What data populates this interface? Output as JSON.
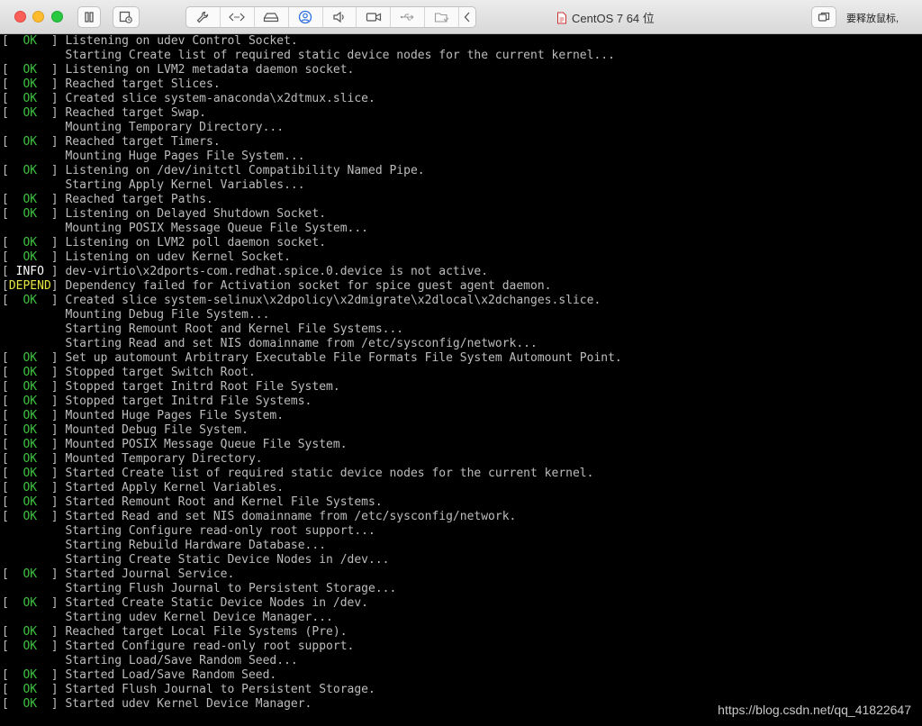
{
  "window": {
    "title": "CentOS 7 64 位",
    "hint_text": "要释放鼠标,",
    "toolbar": {
      "icons": [
        "pause-icon",
        "snapshot-icon",
        "wrench-icon",
        "code-arrows-icon",
        "disk-icon",
        "user-icon",
        "speaker-icon",
        "camera-icon",
        "usb-icon",
        "shared-folder-icon",
        "chevron-left-icon",
        "fullscreen-icon"
      ]
    }
  },
  "terminal": {
    "lines": [
      {
        "status": "OK",
        "text": "Listening on udev Control Socket."
      },
      {
        "status": "",
        "text": "Starting Create list of required static device nodes for the current kernel..."
      },
      {
        "status": "OK",
        "text": "Listening on LVM2 metadata daemon socket."
      },
      {
        "status": "OK",
        "text": "Reached target Slices."
      },
      {
        "status": "OK",
        "text": "Created slice system-anaconda\\x2dtmux.slice."
      },
      {
        "status": "OK",
        "text": "Reached target Swap."
      },
      {
        "status": "",
        "text": "Mounting Temporary Directory..."
      },
      {
        "status": "OK",
        "text": "Reached target Timers."
      },
      {
        "status": "",
        "text": "Mounting Huge Pages File System..."
      },
      {
        "status": "OK",
        "text": "Listening on /dev/initctl Compatibility Named Pipe."
      },
      {
        "status": "",
        "text": "Starting Apply Kernel Variables..."
      },
      {
        "status": "OK",
        "text": "Reached target Paths."
      },
      {
        "status": "OK",
        "text": "Listening on Delayed Shutdown Socket."
      },
      {
        "status": "",
        "text": "Mounting POSIX Message Queue File System..."
      },
      {
        "status": "OK",
        "text": "Listening on LVM2 poll daemon socket."
      },
      {
        "status": "OK",
        "text": "Listening on udev Kernel Socket."
      },
      {
        "status": "INFO",
        "text": "dev-virtio\\x2dports-com.redhat.spice.0.device is not active."
      },
      {
        "status": "DEPEND",
        "text": "Dependency failed for Activation socket for spice guest agent daemon."
      },
      {
        "status": "OK",
        "text": "Created slice system-selinux\\x2dpolicy\\x2dmigrate\\x2dlocal\\x2dchanges.slice."
      },
      {
        "status": "",
        "text": "Mounting Debug File System..."
      },
      {
        "status": "",
        "text": "Starting Remount Root and Kernel File Systems..."
      },
      {
        "status": "",
        "text": "Starting Read and set NIS domainname from /etc/sysconfig/network..."
      },
      {
        "status": "OK",
        "text": "Set up automount Arbitrary Executable File Formats File System Automount Point."
      },
      {
        "status": "OK",
        "text": "Stopped target Switch Root."
      },
      {
        "status": "OK",
        "text": "Stopped target Initrd Root File System."
      },
      {
        "status": "OK",
        "text": "Stopped target Initrd File Systems."
      },
      {
        "status": "OK",
        "text": "Mounted Huge Pages File System."
      },
      {
        "status": "OK",
        "text": "Mounted Debug File System."
      },
      {
        "status": "OK",
        "text": "Mounted POSIX Message Queue File System."
      },
      {
        "status": "OK",
        "text": "Mounted Temporary Directory."
      },
      {
        "status": "OK",
        "text": "Started Create list of required static device nodes for the current kernel."
      },
      {
        "status": "OK",
        "text": "Started Apply Kernel Variables."
      },
      {
        "status": "OK",
        "text": "Started Remount Root and Kernel File Systems."
      },
      {
        "status": "OK",
        "text": "Started Read and set NIS domainname from /etc/sysconfig/network."
      },
      {
        "status": "",
        "text": "Starting Configure read-only root support..."
      },
      {
        "status": "",
        "text": "Starting Rebuild Hardware Database..."
      },
      {
        "status": "",
        "text": "Starting Create Static Device Nodes in /dev..."
      },
      {
        "status": "OK",
        "text": "Started Journal Service."
      },
      {
        "status": "",
        "text": "Starting Flush Journal to Persistent Storage..."
      },
      {
        "status": "OK",
        "text": "Started Create Static Device Nodes in /dev."
      },
      {
        "status": "",
        "text": "Starting udev Kernel Device Manager..."
      },
      {
        "status": "OK",
        "text": "Reached target Local File Systems (Pre)."
      },
      {
        "status": "OK",
        "text": "Started Configure read-only root support."
      },
      {
        "status": "",
        "text": "Starting Load/Save Random Seed..."
      },
      {
        "status": "OK",
        "text": "Started Load/Save Random Seed."
      },
      {
        "status": "OK",
        "text": "Started Flush Journal to Persistent Storage."
      },
      {
        "status": "OK",
        "text": "Started udev Kernel Device Manager."
      }
    ]
  },
  "watermark": "https://blog.csdn.net/qq_41822647"
}
